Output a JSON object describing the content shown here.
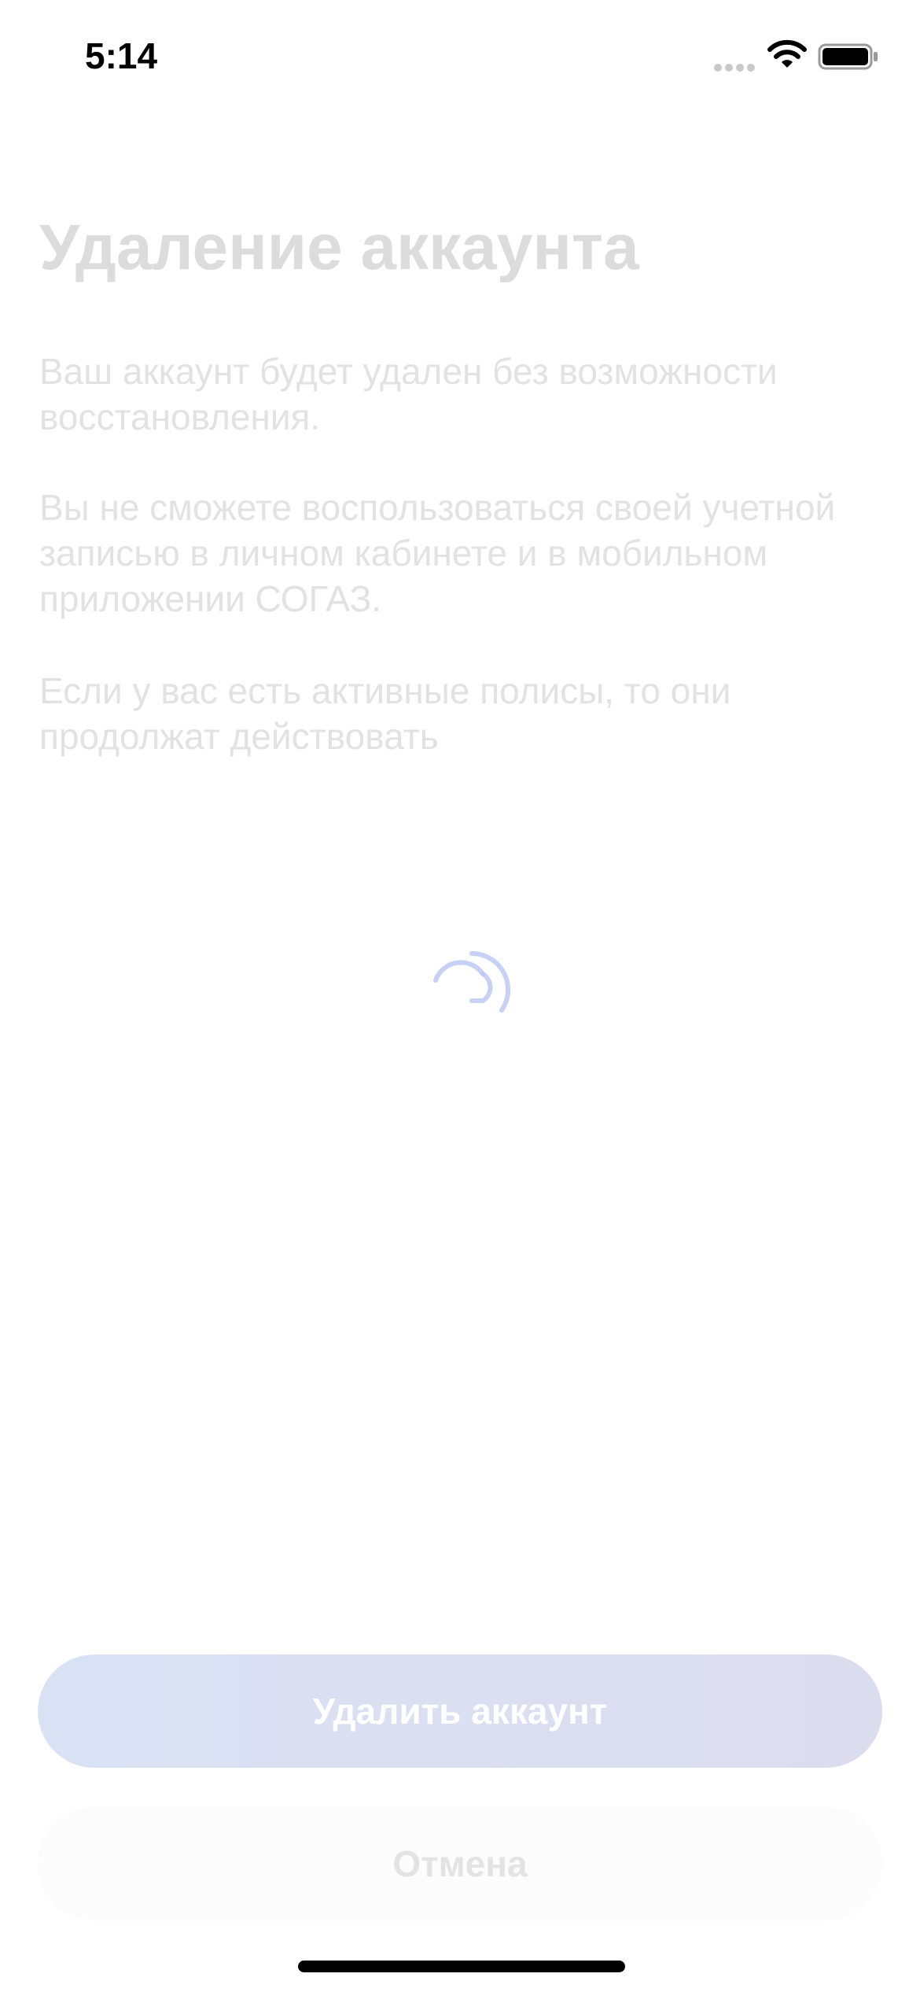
{
  "status_bar": {
    "time": "5:14",
    "icons": [
      "signal-dots-icon",
      "wifi-icon",
      "battery-icon"
    ]
  },
  "screen": {
    "title": "Удаление аккаунта",
    "paragraphs": [
      "Ваш аккаунт будет удален без возможности восстановления.",
      "Вы не сможете воспользоваться своей учетной записью в личном кабинете и в мобильном приложении СОГАЗ.",
      "Если у вас есть активные полисы, то они продолжат действовать"
    ]
  },
  "loading": {
    "icon": "loading-spinner-icon",
    "color": "#b8c6f2"
  },
  "actions": {
    "delete_label": "Удалить аккаунт",
    "cancel_label": "Отмена"
  },
  "colors": {
    "title": "#dcdcde",
    "body_text": "#e2e2e4",
    "delete_button_bg": "#d9e2f4",
    "cancel_button_bg": "#fcfcfd"
  }
}
